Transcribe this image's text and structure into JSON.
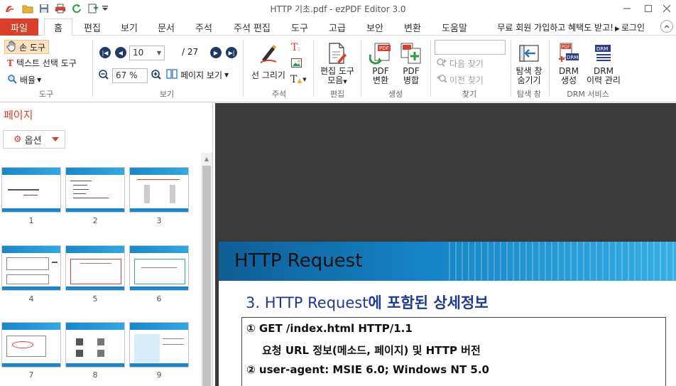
{
  "window": {
    "title": "HTTP 기초.pdf - ezPDF Editor 3.0"
  },
  "menu": {
    "file_label": "파일",
    "tabs": [
      "홈",
      "편집",
      "보기",
      "문서",
      "주석",
      "주석 편집",
      "도구",
      "고급",
      "보안",
      "변환",
      "도움말"
    ],
    "promo": "무료 회원 가입하고 혜택도 받고!",
    "login": "로그인"
  },
  "ribbon": {
    "tools": {
      "hand": "손 도구",
      "text_select": "텍스트 선택 도구",
      "zoom": "배율",
      "label": "도구"
    },
    "view": {
      "page_current": "10",
      "page_total": "/ 27",
      "zoom_value": "67 %",
      "page_view": "페이지 보기",
      "label": "보기"
    },
    "annot": {
      "draw_line": "선 그리기",
      "label": "주석"
    },
    "edit": {
      "tools_line1": "편집 도구",
      "tools_line2": "모음",
      "label": "편집"
    },
    "create": {
      "convert_line1": "PDF",
      "convert_line2": "변환",
      "merge_line1": "PDF",
      "merge_line2": "병합",
      "label": "생성"
    },
    "find": {
      "next": "다음 찾기",
      "prev": "이전 찾기",
      "label": "찾기"
    },
    "navpane": {
      "line1": "탐색 창",
      "line2": "숨기기",
      "label": "탐색 창"
    },
    "drm": {
      "create_line1": "DRM",
      "create_line2": "생성",
      "history_line1": "DRM",
      "history_line2": "이력 관리",
      "label": "DRM 서비스"
    }
  },
  "sidebar": {
    "title": "페이지",
    "options": "옵션",
    "thumbnails": [
      "1",
      "2",
      "3",
      "4",
      "5",
      "6",
      "7",
      "8",
      "9"
    ]
  },
  "document": {
    "page_title": "HTTP Request",
    "section_num": "3.",
    "section_text": "HTTP Request",
    "section_bold": "에 포함된 상세정보",
    "lines": [
      "① GET /index.html HTTP/1.1",
      "요청 URL 정보(메소드, 페이지) 및 HTTP 버전",
      "② user-agent: MSIE 6.0; Windows NT 5.0"
    ]
  },
  "colors": {
    "accent": "#d9402b",
    "banner": "#1583c6",
    "section_title": "#1e3a8a",
    "nav_button": "#1f3a64"
  }
}
